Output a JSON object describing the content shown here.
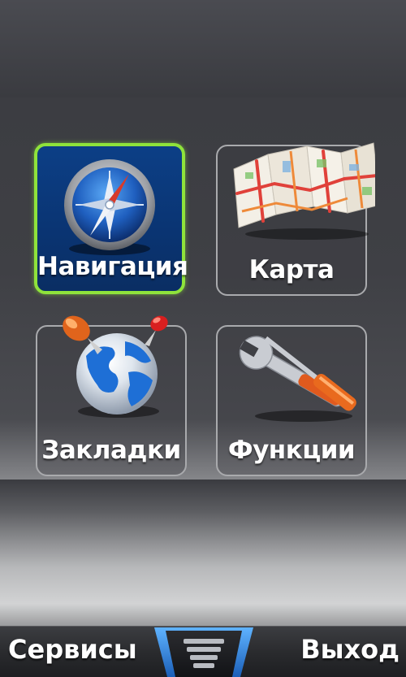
{
  "menu": {
    "tiles": [
      {
        "label": "Навигация",
        "icon": "compass-icon",
        "selected": true
      },
      {
        "label": "Карта",
        "icon": "map-icon",
        "selected": false
      },
      {
        "label": "Закладки",
        "icon": "globe-pins-icon",
        "selected": false
      },
      {
        "label": "Функции",
        "icon": "tools-icon",
        "selected": false
      }
    ]
  },
  "softkeys": {
    "left_label": "Сервисы",
    "right_label": "Выход",
    "center_icon": "menu-handle-icon"
  },
  "colors": {
    "selection_border": "#8fe33b",
    "selected_tile_bg": "#0c3f86",
    "center_key_accent": "#2f8be6"
  }
}
